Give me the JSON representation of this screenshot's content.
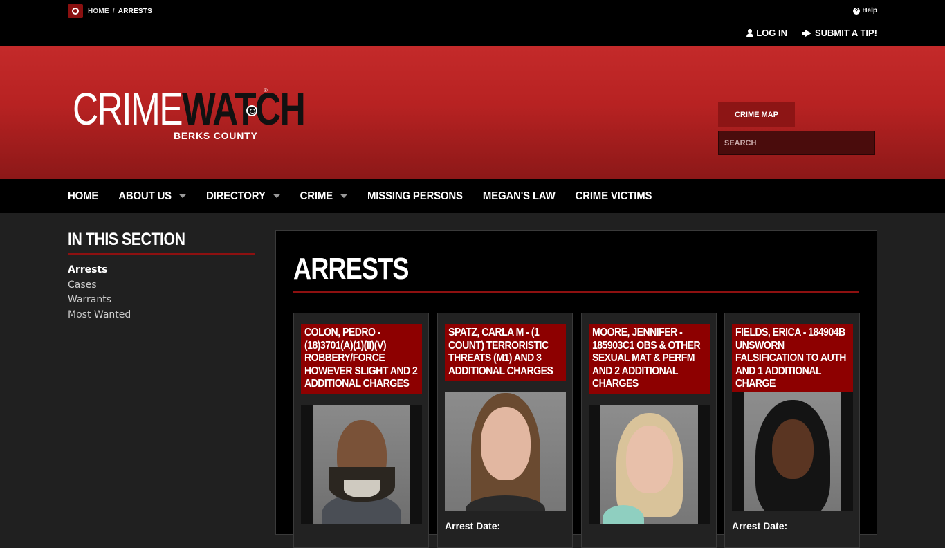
{
  "topbar": {
    "breadcrumb": {
      "home": "HOME",
      "separator": "/",
      "current": "ARRESTS"
    },
    "help": "Help",
    "login": "LOG IN",
    "submit_tip": "SUBMIT A TIP!"
  },
  "header": {
    "logo_crime": "CRIME",
    "logo_watch": "WATCH",
    "logo_reg": "®",
    "logo_sub": "BERKS COUNTY",
    "crime_map": "CRIME MAP",
    "search_placeholder": "SEARCH"
  },
  "nav": {
    "items": [
      {
        "label": "HOME",
        "dropdown": false
      },
      {
        "label": "ABOUT US",
        "dropdown": true
      },
      {
        "label": "DIRECTORY",
        "dropdown": true
      },
      {
        "label": "CRIME",
        "dropdown": true
      },
      {
        "label": "MISSING PERSONS",
        "dropdown": false
      },
      {
        "label": "MEGAN'S LAW",
        "dropdown": false
      },
      {
        "label": "CRIME VICTIMS",
        "dropdown": false
      }
    ]
  },
  "sidebar": {
    "title": "IN THIS SECTION",
    "links": [
      {
        "label": "Arrests",
        "active": true
      },
      {
        "label": "Cases",
        "active": false
      },
      {
        "label": "Warrants",
        "active": false
      },
      {
        "label": "Most Wanted",
        "active": false
      }
    ]
  },
  "main": {
    "title": "ARRESTS",
    "cards": [
      {
        "title": "COLON, PEDRO - (18)3701(A)(1)(II)(V) ROBBERY/FORCE HOWEVER SLIGHT AND 2 ADDITIONAL CHARGES",
        "arrest_label": ""
      },
      {
        "title": "SPATZ, CARLA M - (1 COUNT) TERRORISTIC THREATS (M1) AND 3 ADDITIONAL CHARGES",
        "arrest_label": "Arrest Date:"
      },
      {
        "title": "MOORE, JENNIFER - 185903C1 OBS & OTHER SEXUAL MAT & PERFM AND 2 ADDITIONAL CHARGES",
        "arrest_label": ""
      },
      {
        "title": "FIELDS, ERICA - 184904B UNSWORN FALSIFICATION TO AUTH AND 1 ADDITIONAL CHARGE",
        "arrest_label": "Arrest Date:"
      }
    ]
  },
  "colors": {
    "accent": "#8d1010",
    "header_red": "#c42a2a",
    "card_title_bg": "#8d0000"
  }
}
